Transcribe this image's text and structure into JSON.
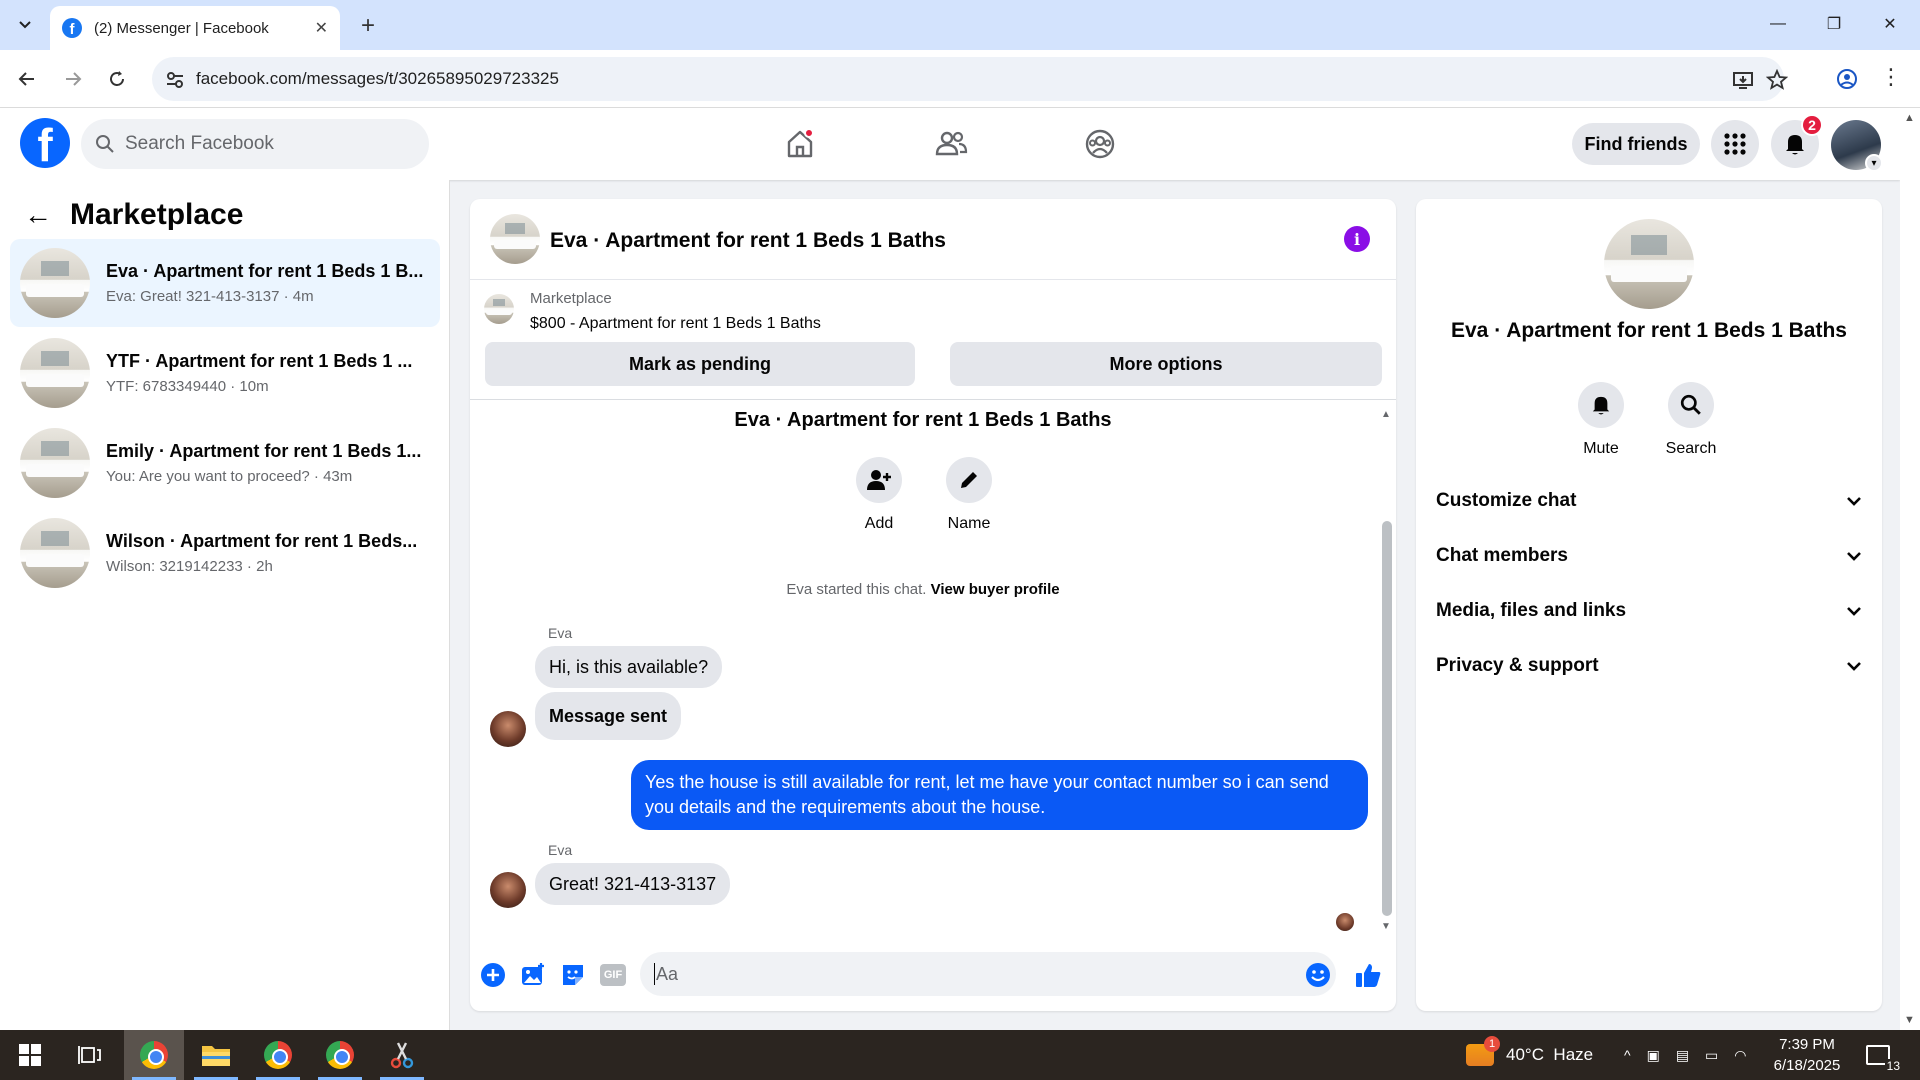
{
  "browser": {
    "tab_title": "(2) Messenger | Facebook",
    "url": "facebook.com/messages/t/30265895029723325"
  },
  "fb": {
    "search_placeholder": "Search Facebook",
    "find_friends": "Find friends",
    "notif_count": "2",
    "brand_color": "#0866ff"
  },
  "sidebar": {
    "title": "Marketplace",
    "conversations": [
      {
        "name": "Eva · Apartment for rent 1 Beds 1 B...",
        "preview": "Eva: Great! 321-413-3137 · 4m"
      },
      {
        "name": "YTF · Apartment for rent 1 Beds 1 ...",
        "preview": "YTF: 6783349440 · 10m"
      },
      {
        "name": "Emily · Apartment for rent 1 Beds 1...",
        "preview": "You: Are you want to proceed? · 43m"
      },
      {
        "name": "Wilson · Apartment for rent 1 Beds...",
        "preview": "Wilson: 3219142233 · 2h"
      }
    ]
  },
  "chat": {
    "header_name": "Eva · Apartment for rent 1 Beds 1 Baths",
    "listing_label": "Marketplace",
    "listing_detail": "$800 - Apartment for rent 1 Beds 1 Baths",
    "mark_pending": "Mark as pending",
    "more_options": "More options",
    "conv_title": "Eva · Apartment for rent 1 Beds 1 Baths",
    "add_label": "Add",
    "name_label": "Name",
    "started_text": "Eva started this chat.",
    "started_link": "View buyer profile",
    "messages": [
      {
        "sender": "Eva",
        "text": "Hi, is this available?"
      },
      {
        "text": "Message sent"
      },
      {
        "text": "Yes the house is still available for rent, let me have your contact number so i can send you details and the requirements about the house."
      },
      {
        "sender": "Eva",
        "text": "Great! 321-413-3137"
      }
    ],
    "composer_placeholder": "Aa",
    "gif_label": "GIF",
    "bubble_color": "#0a59f5"
  },
  "info_panel": {
    "name": "Eva · Apartment for rent 1 Beds 1 Baths",
    "mute": "Mute",
    "search": "Search",
    "sections": [
      "Customize chat",
      "Chat members",
      "Media, files and links",
      "Privacy & support"
    ]
  },
  "taskbar": {
    "weather": "40°C  Haze",
    "weather_badge": "1",
    "time": "7:39 PM",
    "date": "6/18/2025",
    "notif_count": "13"
  }
}
